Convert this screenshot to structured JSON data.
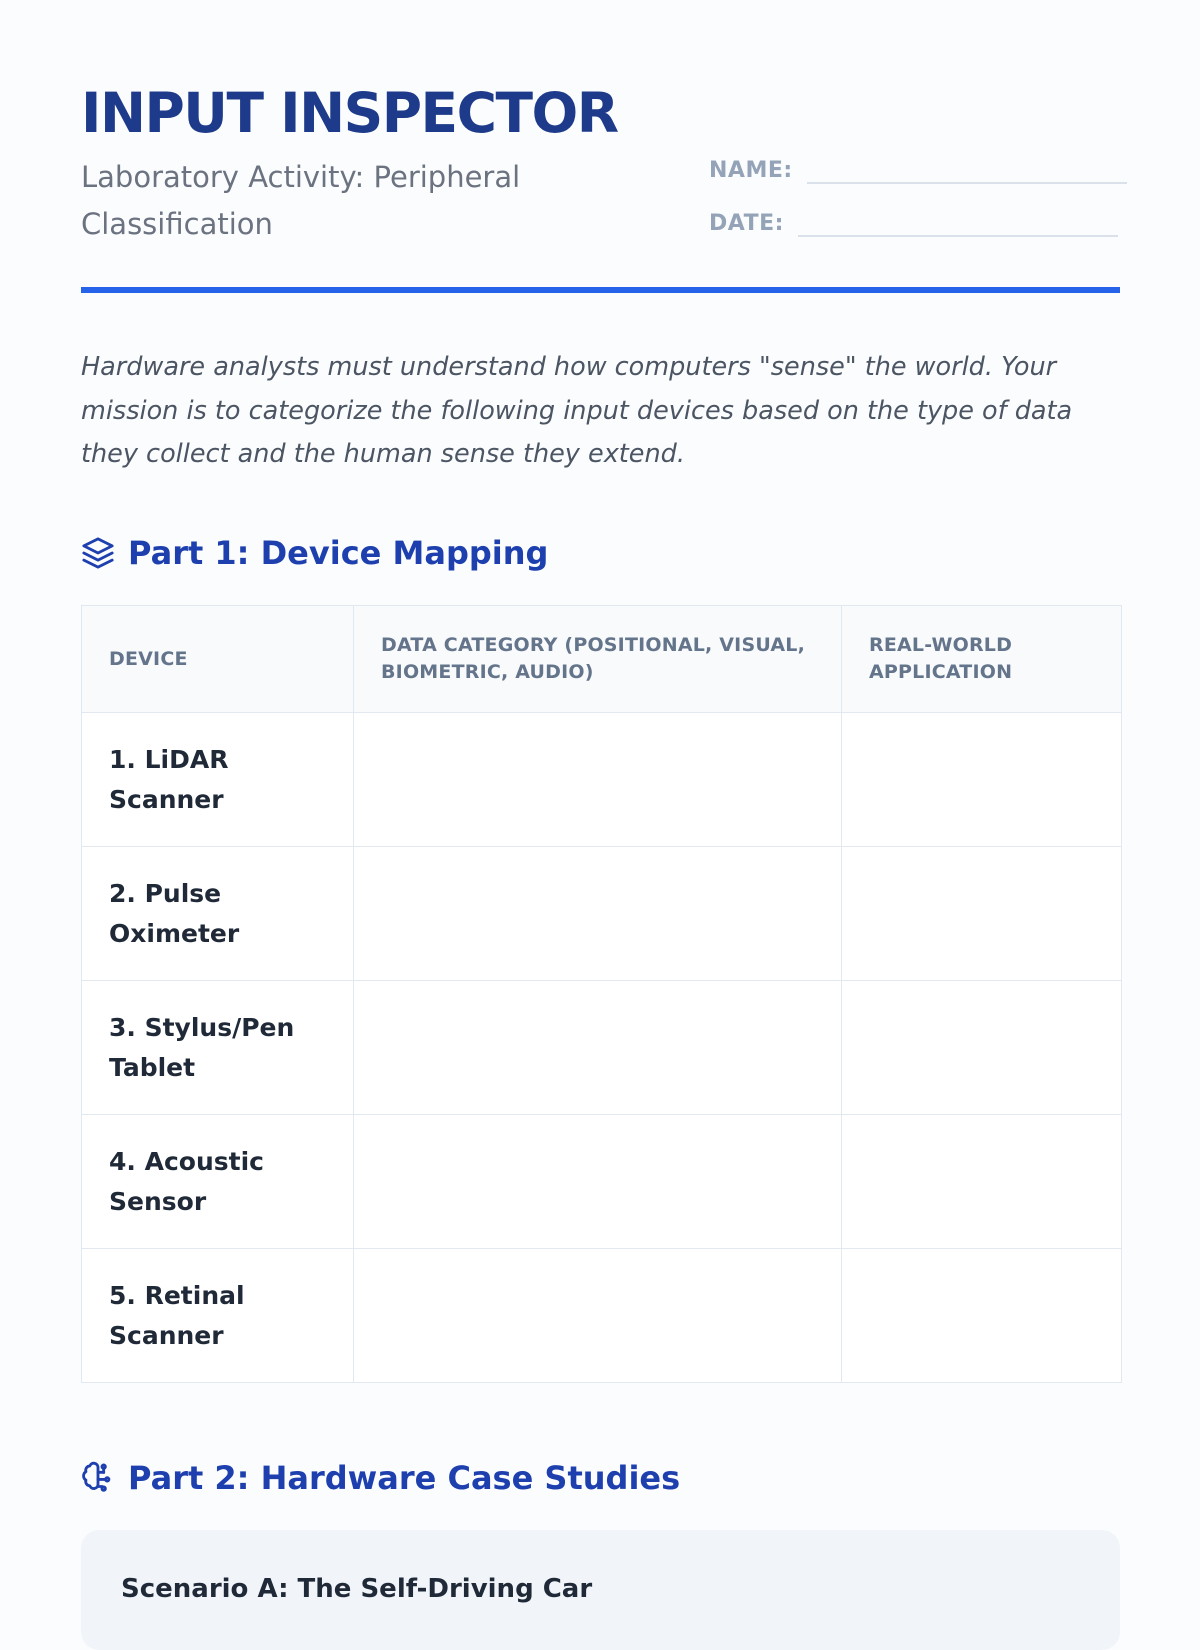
{
  "header": {
    "title": "INPUT INSPECTOR",
    "subtitle": "Laboratory Activity: Peripheral Classification",
    "name_label": "NAME:",
    "date_label": "DATE:"
  },
  "intro": "Hardware analysts must understand how computers \"sense\" the world. Your mission is to categorize the following input devices based on the type of data they collect and the human sense they extend.",
  "part1": {
    "icon": "layers-icon",
    "heading": "Part 1: Device Mapping",
    "columns": [
      "DEVICE",
      "DATA CATEGORY (POSITIONAL, VISUAL, BIOMETRIC, AUDIO)",
      "REAL-WORLD APPLICATION"
    ],
    "rows": [
      {
        "device": "1. LiDAR Scanner",
        "category": "",
        "application": ""
      },
      {
        "device": "2. Pulse Oximeter",
        "category": "",
        "application": ""
      },
      {
        "device": "3. Stylus/Pen Tablet",
        "category": "",
        "application": ""
      },
      {
        "device": "4. Acoustic Sensor",
        "category": "",
        "application": ""
      },
      {
        "device": "5. Retinal Scanner",
        "category": "",
        "application": ""
      }
    ]
  },
  "part2": {
    "icon": "brain-circuit-icon",
    "heading": "Part 2: Hardware Case Studies",
    "scenario_a_title": "Scenario A: The Self-Driving Car"
  },
  "colors": {
    "title": "#1e3a8a",
    "accent": "#2563eb",
    "section_heading": "#1e40af",
    "muted": "#6b7280"
  }
}
